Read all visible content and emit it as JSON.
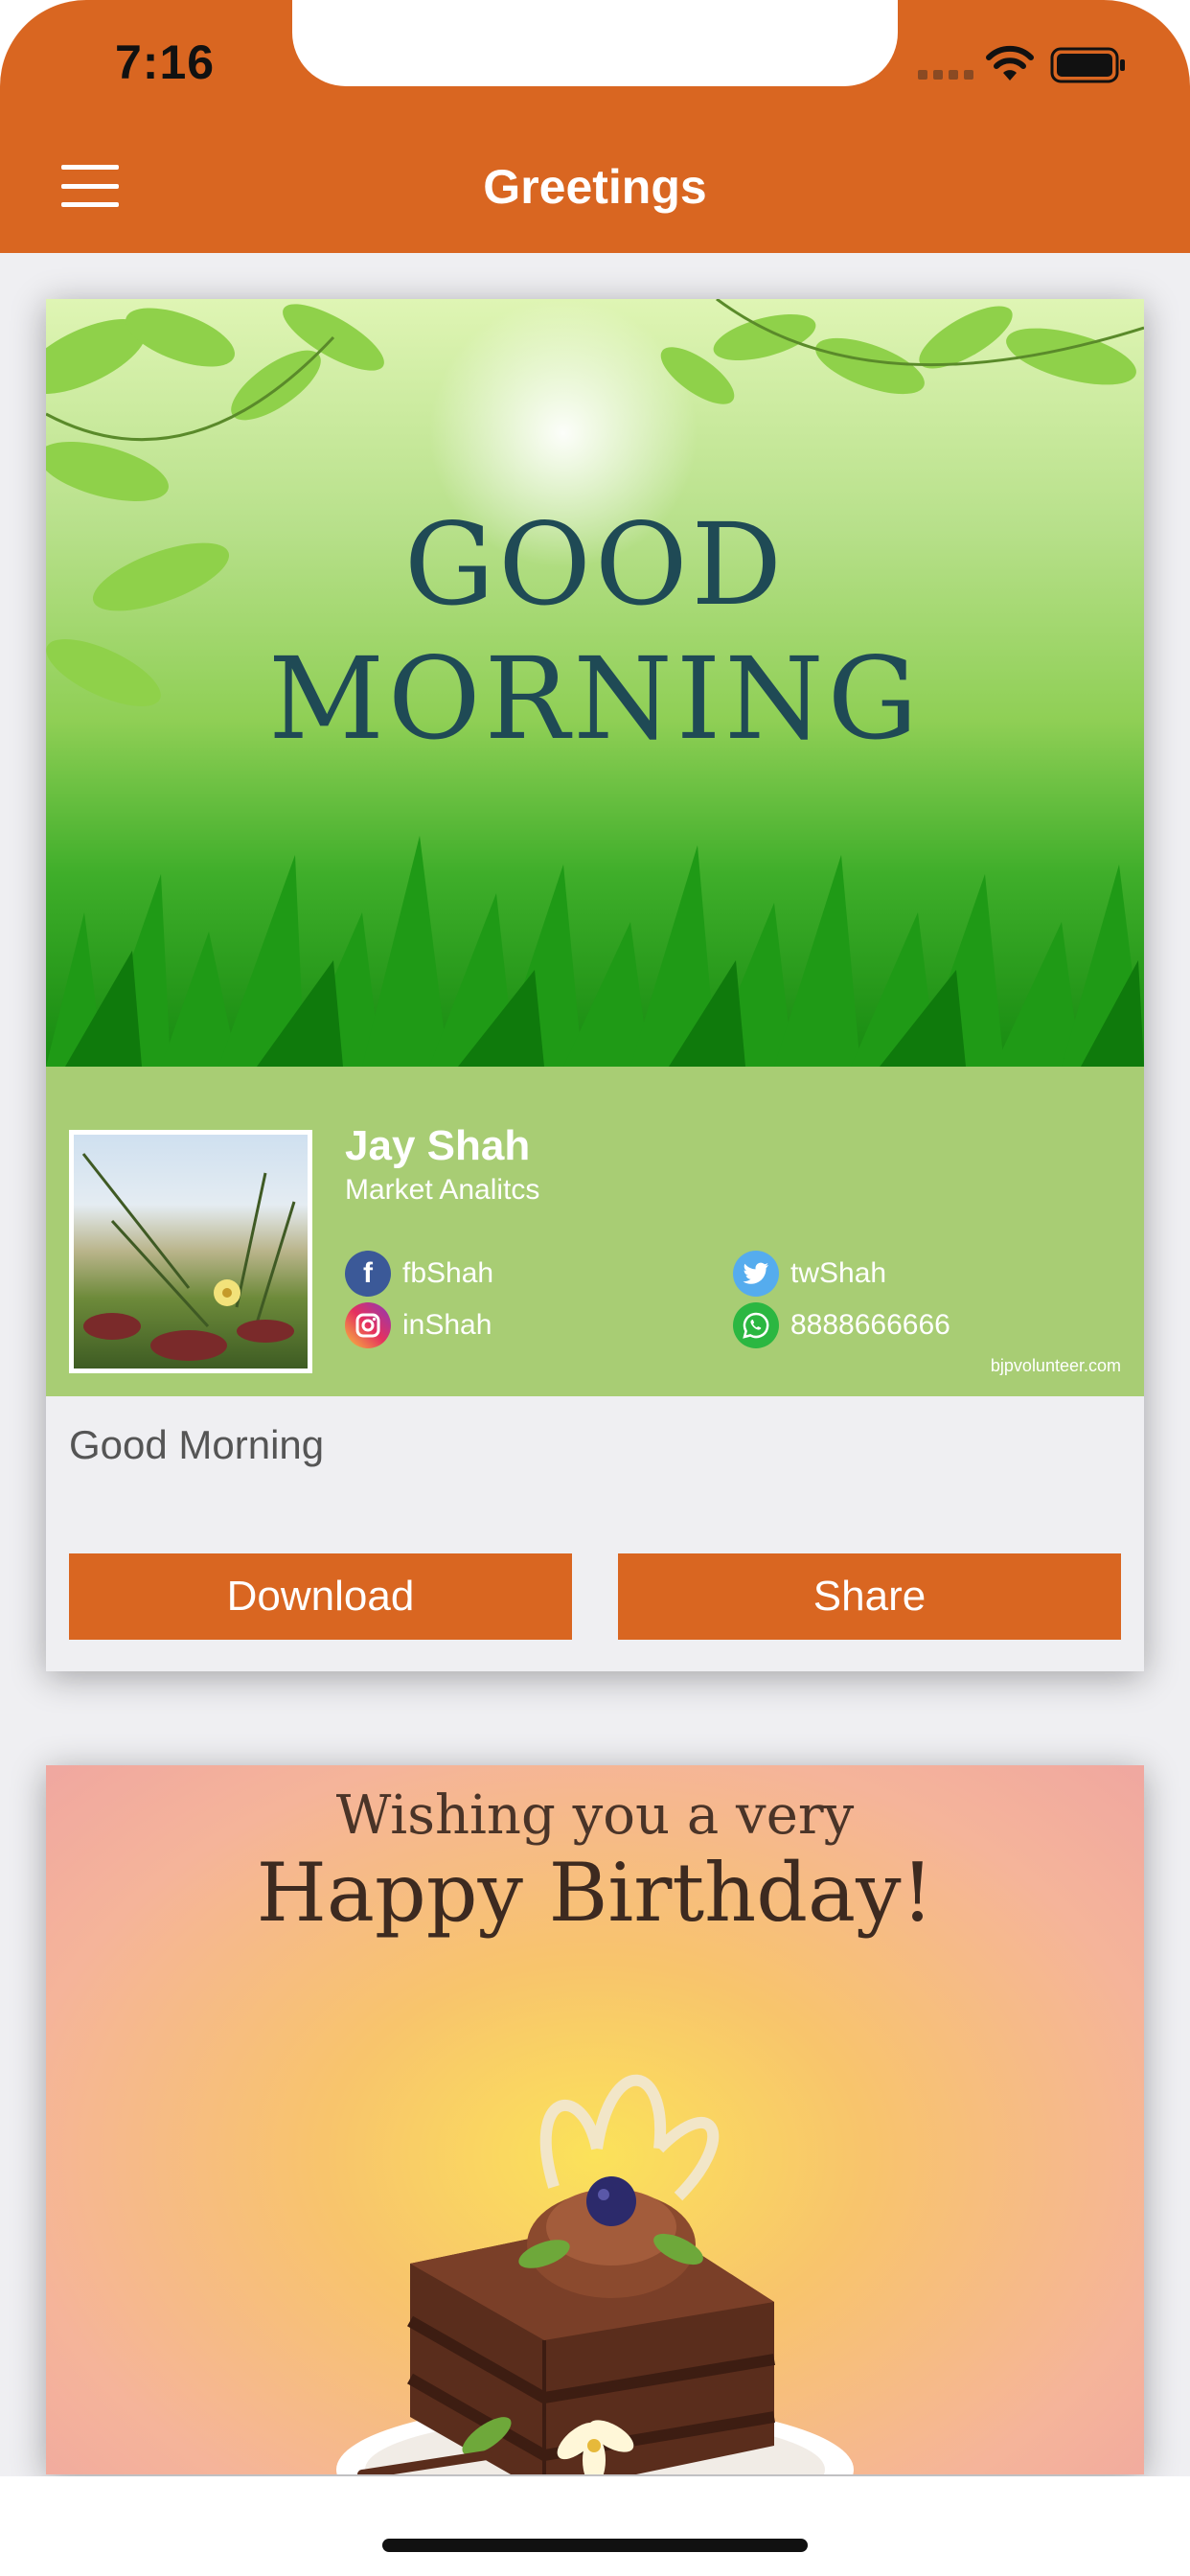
{
  "status_bar": {
    "time": "7:16"
  },
  "header": {
    "title": "Greetings",
    "menu_icon": "hamburger-menu-icon",
    "background_color": "#d96621"
  },
  "cards": [
    {
      "image_text": [
        "GOOD",
        "MORNING"
      ],
      "profile": {
        "name": "Jay Shah",
        "role": "Market Analitcs",
        "social": {
          "facebook": "fbShah",
          "twitter": "twShah",
          "instagram": "inShah",
          "whatsapp": "8888666666"
        },
        "website": "bjpvolunteer.com"
      },
      "caption": "Good Morning",
      "actions": {
        "download": "Download",
        "share": "Share"
      }
    },
    {
      "image_text": [
        "Wishing you a very",
        "Happy Birthday!"
      ]
    }
  ],
  "colors": {
    "accent": "#d96621",
    "profile_band": "#a8cd74"
  }
}
